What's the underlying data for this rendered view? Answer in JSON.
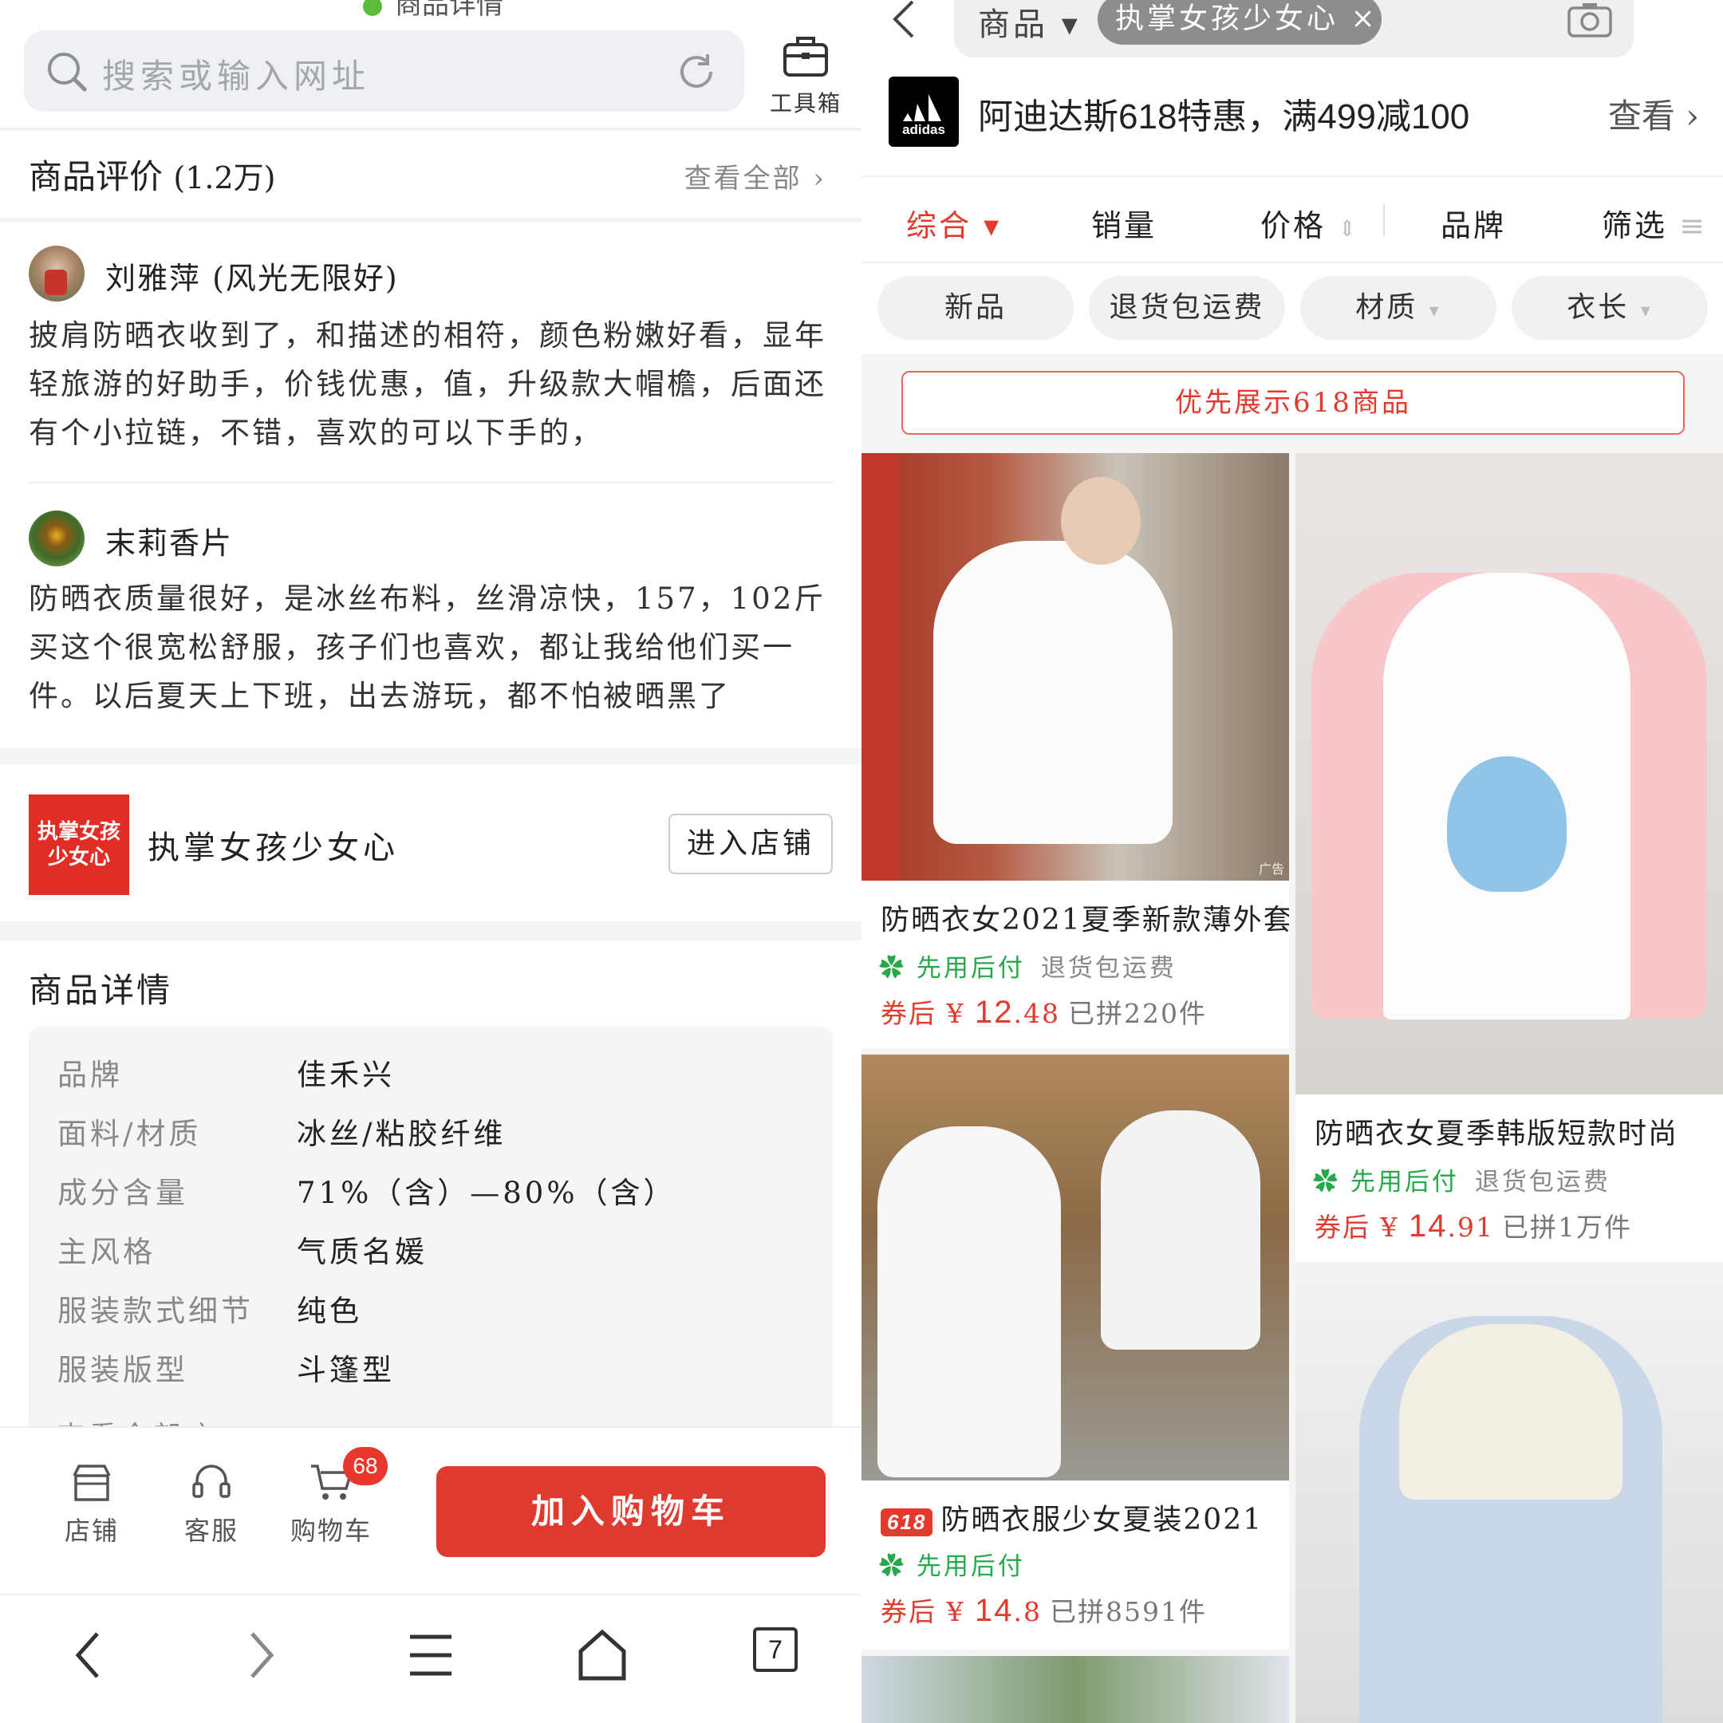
{
  "left": {
    "top_title": "商品详情",
    "search_placeholder": "搜索或输入网址",
    "toolbox_label": "工具箱",
    "reviews": {
      "title": "商品评价",
      "count": "(1.2万)",
      "see_all": "查看全部",
      "items": [
        {
          "name": "刘雅萍 (风光无限好)",
          "text": "披肩防晒衣收到了，和描述的相符，颜色粉嫩好看，显年轻旅游的好助手，价钱优惠，值，升级款大帽檐，后面还有个小拉链，不错，喜欢的可以下手的，"
        },
        {
          "name": "末莉香片",
          "text": "防晒衣质量很好，是冰丝布料，丝滑凉快，157，102斤买这个很宽松舒服，孩子们也喜欢，都让我给他们买一件。以后夏天上下班，出去游玩，都不怕被晒黑了"
        }
      ]
    },
    "shop": {
      "logo_line1": "执掌女孩",
      "logo_line2": "少女心",
      "name": "执掌女孩少女心",
      "enter_label": "进入店铺"
    },
    "details": {
      "title": "商品详情",
      "rows": [
        {
          "k": "品牌",
          "v": "佳禾兴"
        },
        {
          "k": "面料/材质",
          "v": "冰丝/粘胶纤维"
        },
        {
          "k": "成分含量",
          "v": "71%（含）—80%（含）"
        },
        {
          "k": "主风格",
          "v": "气质名媛"
        },
        {
          "k": "服装款式细节",
          "v": "纯色"
        },
        {
          "k": "服装版型",
          "v": "斗篷型"
        }
      ],
      "see_more": "查看全部"
    },
    "bottom_bar": {
      "shop": "店铺",
      "service": "客服",
      "cart": "购物车",
      "cart_badge": "68",
      "add_to_cart": "加入购物车"
    },
    "nav": {
      "tabs_count": "7"
    }
  },
  "right": {
    "search": {
      "scope": "商品",
      "chip": "执掌女孩少女心"
    },
    "ad": {
      "logo_text": "adidas",
      "text": "阿迪达斯618特惠，满499减100",
      "more": "查看"
    },
    "sort": [
      "综合",
      "销量",
      "价格",
      "品牌",
      "筛选"
    ],
    "filters": [
      "新品",
      "退货包运费",
      "材质",
      "衣长"
    ],
    "promo": "优先展示618商品",
    "products": [
      {
        "title": "防晒衣女2021夏季新款薄外套",
        "badge_ad": "广告",
        "feature": "先用后付",
        "feature2": "退货包运费",
        "price_prefix": "券后 ¥",
        "price_int": "12",
        "price_dec": ".48",
        "sold": "已拼220件"
      },
      {
        "title": "防晒衣女夏季韩版短款时尚",
        "feature": "先用后付",
        "feature2": "退货包运费",
        "price_prefix": "券后 ¥",
        "price_int": "14",
        "price_dec": ".91",
        "sold": "已拼1万件"
      },
      {
        "tag": "618",
        "title": "防晒衣服少女夏装2021",
        "feature": "先用后付",
        "price_prefix": "券后 ¥",
        "price_int": "14",
        "price_dec": ".8",
        "sold": "已拼8591件"
      }
    ],
    "colors": {
      "accent": "#e23b2e",
      "green": "#27a84a"
    }
  }
}
